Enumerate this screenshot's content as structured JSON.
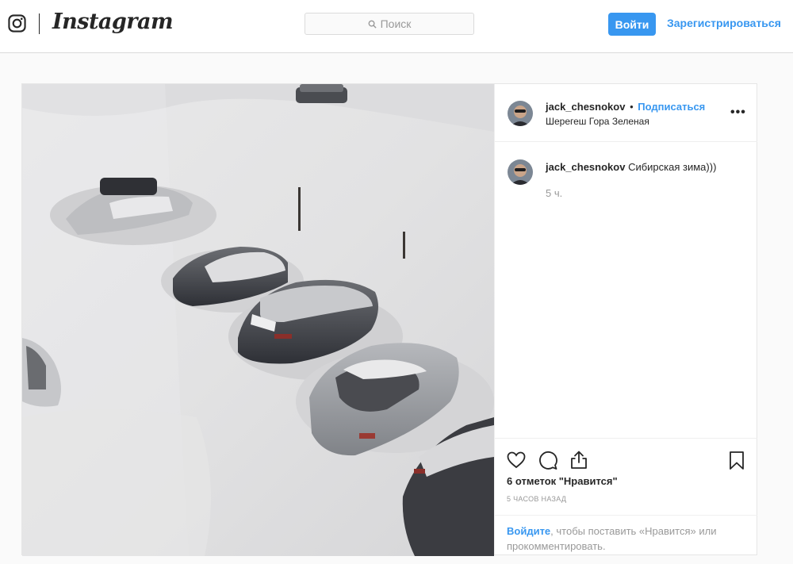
{
  "header": {
    "wordmark": "Instagram",
    "search_placeholder": "Поиск",
    "login_label": "Войти",
    "signup_label": "Зарегистрироваться"
  },
  "post": {
    "username": "jack_chesnokov",
    "dot": "•",
    "follow_label": "Подписаться",
    "location": "Шерегеш Гора Зеленая",
    "more_label": "•••",
    "caption_text": "Сибирская зима)))",
    "caption_time": "5 ч.",
    "likes": "6 отметок \"Нравится\"",
    "time_ago": "5 часов назад",
    "login_link": "Войдите",
    "login_prompt_rest": ", чтобы поставить «Нравится» или прокомментировать."
  },
  "icons": {
    "logo": "instagram-glyph-icon",
    "search": "search-icon",
    "like": "heart-icon",
    "comment": "comment-icon",
    "share": "share-icon",
    "save": "bookmark-icon"
  },
  "colors": {
    "accent": "#3897f0",
    "text": "#262626",
    "muted": "#999999",
    "border": "#dbdbdb",
    "background": "#fafafa"
  }
}
